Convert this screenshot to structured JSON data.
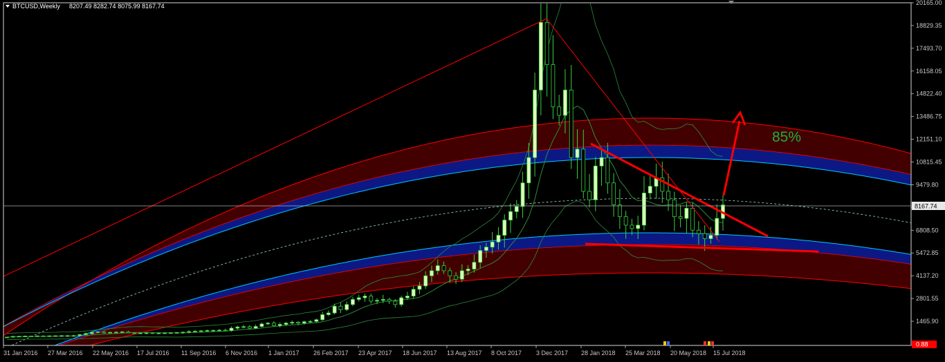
{
  "header": {
    "symbol": "BTCUSD,Weekly",
    "ohlc": "8207.49 8282.74 8075.99 8167.74"
  },
  "annotation": {
    "text": "85%"
  },
  "chart_data": {
    "type": "candlestick",
    "title": "BTCUSD,Weekly",
    "ohlc_last": {
      "open": 8207.49,
      "high": 8282.74,
      "low": 8075.99,
      "close": 8167.74
    },
    "current_price_label": "8167.74",
    "low_price_label": "0.88",
    "y_tick_labels": [
      "20165.00",
      "18829.35",
      "17493.70",
      "16158.05",
      "14822.40",
      "13486.75",
      "12151.10",
      "10815.45",
      "9479.80",
      "8144.15",
      "6808.50",
      "5472.85",
      "4137.20",
      "2801.55",
      "1465.90"
    ],
    "y_range": [
      0.88,
      20165
    ],
    "x_tick_labels": [
      "31 Jan 2016",
      "27 Mar 2016",
      "22 May 2016",
      "17 Jul 2016",
      "11 Sep 2016",
      "6 Nov 2016",
      "1 Jan 2017",
      "26 Feb 2017",
      "23 Apr 2017",
      "18 Jun 2017",
      "13 Aug 2017",
      "8 Oct 2017",
      "3 Dec 2017",
      "28 Jan 2018",
      "25 Mar 2018",
      "20 May 2018",
      "15 Jul 2018"
    ],
    "weekly_close_approx": [
      370,
      410,
      420,
      430,
      415,
      440,
      430,
      445,
      450,
      455,
      455,
      460,
      520,
      580,
      650,
      680,
      620,
      650,
      660,
      680,
      620,
      600,
      610,
      620,
      610,
      610,
      620,
      630,
      640,
      660,
      700,
      720,
      740,
      760,
      770,
      780,
      760,
      900,
      970,
      990,
      900,
      1000,
      1150,
      1200,
      1050,
      1120,
      1200,
      1250,
      1200,
      1280,
      1300,
      1400,
      1700,
      1800,
      2200,
      2000,
      2300,
      2600,
      2700,
      2800,
      2500,
      2550,
      2600,
      2500,
      2300,
      2700,
      2800,
      3200,
      3400,
      4000,
      4300,
      4600,
      4300,
      4000,
      3800,
      4300,
      4400,
      4800,
      5500,
      5700,
      6000,
      6400,
      7300,
      7800,
      8100,
      9500,
      11000,
      15000,
      19000,
      16500,
      14000,
      13500,
      15000,
      11000,
      11500,
      9000,
      8500,
      10500,
      11000,
      9500,
      8200,
      7500,
      7000,
      6800,
      7000,
      8900,
      9300,
      9800,
      9000,
      8500,
      7500,
      7400,
      8000,
      6700,
      6500,
      6200,
      6400,
      7400,
      8200
    ]
  },
  "colors": {
    "background": "#000000",
    "bull_candle": "#ddffbb",
    "wick": "#39d33f",
    "trendline": "#ff0000",
    "fan_fill": "#4a0000",
    "blue_band": "#0d1a8c",
    "cyan_line": "#00c8ff",
    "axis_text": "#c8c8c8",
    "annotation": "#1fae3c"
  }
}
